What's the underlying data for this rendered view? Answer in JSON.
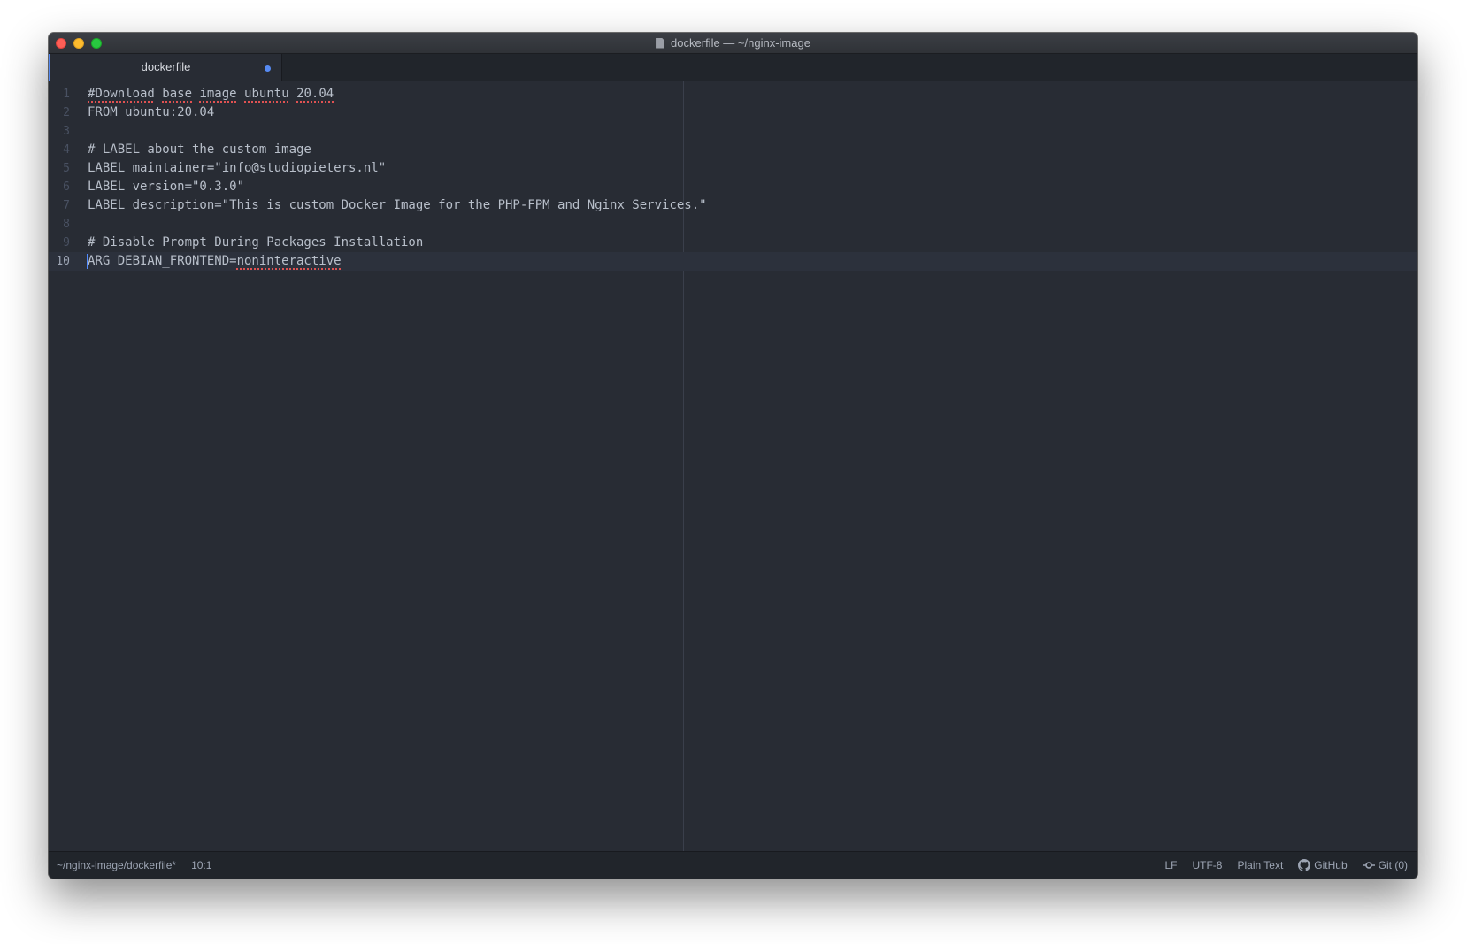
{
  "window": {
    "title": "dockerfile — ~/nginx-image"
  },
  "tabs": [
    {
      "label": "dockerfile",
      "modified": true
    }
  ],
  "editor": {
    "cursor_line": 10,
    "lines": [
      {
        "num": "1",
        "segments": [
          {
            "text": "#Download",
            "spell": true
          },
          {
            "text": " "
          },
          {
            "text": "base",
            "spell": true
          },
          {
            "text": " "
          },
          {
            "text": "image",
            "spell": true
          },
          {
            "text": " "
          },
          {
            "text": "ubuntu",
            "spell": true
          },
          {
            "text": " "
          },
          {
            "text": "20.04",
            "spell": true
          }
        ]
      },
      {
        "num": "2",
        "segments": [
          {
            "text": "FROM ubuntu:20.04"
          }
        ]
      },
      {
        "num": "3",
        "segments": []
      },
      {
        "num": "4",
        "segments": [
          {
            "text": "# LABEL about the custom image"
          }
        ]
      },
      {
        "num": "5",
        "segments": [
          {
            "text": "LABEL maintainer=\"info@studiopieters.nl\""
          }
        ]
      },
      {
        "num": "6",
        "segments": [
          {
            "text": "LABEL version=\"0.3.0\""
          }
        ]
      },
      {
        "num": "7",
        "segments": [
          {
            "text": "LABEL description=\"This is custom Docker Image for the PHP-FPM and Nginx Services.\""
          }
        ]
      },
      {
        "num": "8",
        "segments": []
      },
      {
        "num": "9",
        "segments": [
          {
            "text": "# Disable Prompt During Packages Installation"
          }
        ]
      },
      {
        "num": "10",
        "segments": [
          {
            "text": "ARG DEBIAN_FRONTEND="
          },
          {
            "text": "noninteractive",
            "spell": true
          }
        ]
      }
    ]
  },
  "statusbar": {
    "file_path": "~/nginx-image/dockerfile*",
    "cursor_position": "10:1",
    "line_ending": "LF",
    "encoding": "UTF-8",
    "grammar": "Plain Text",
    "github_label": "GitHub",
    "git_label": "Git (0)"
  },
  "icons": {
    "title_file": "document-icon",
    "github": "github-icon",
    "git": "git-commit-icon"
  },
  "colors": {
    "editor_bg": "#282c34",
    "accent": "#568af2",
    "spellcheck": "#e05252"
  }
}
